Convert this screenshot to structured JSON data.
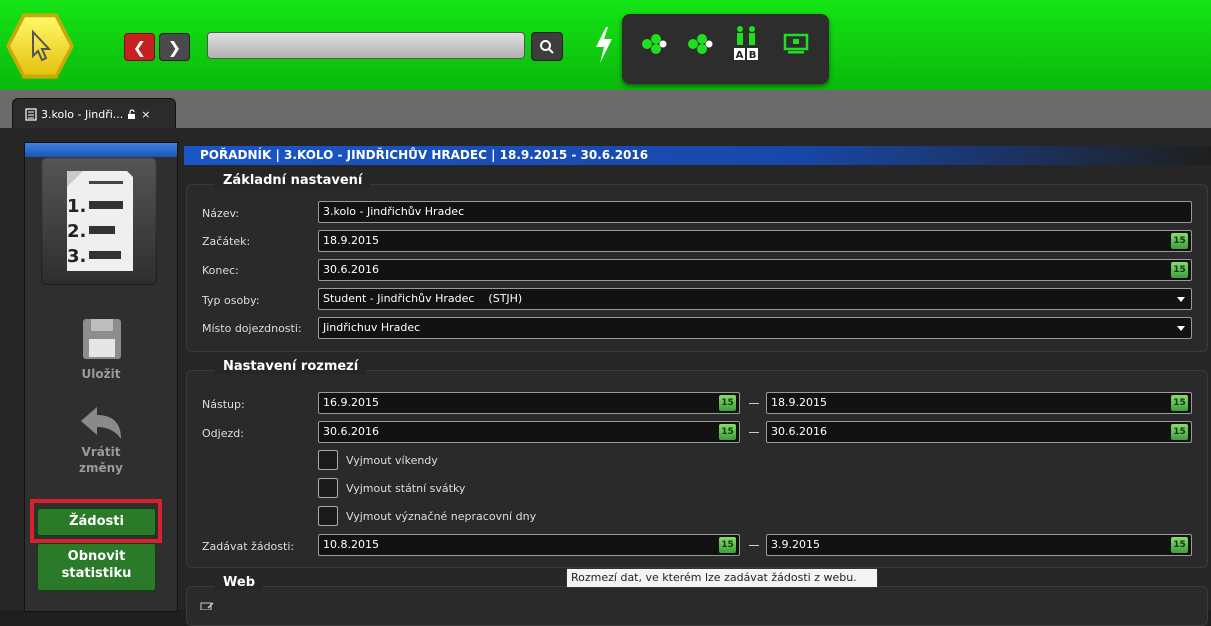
{
  "toolbar": {
    "search_placeholder": "",
    "icons": [
      "cursor-icon",
      "back-arrow-icon",
      "forward-arrow-icon",
      "search-icon",
      "lightning-icon",
      "hexagon-cluster-icon",
      "hexagon-cluster-icon",
      "people-ab-icon",
      "monitor-icon"
    ],
    "tool_ab_label_a": "A",
    "tool_ab_label_b": "B"
  },
  "tab": {
    "label": "3.kolo - Jindři...",
    "close": "×"
  },
  "sidebar": {
    "save_label": "Uložit",
    "revert_line1": "Vrátit",
    "revert_line2": "změny",
    "requests_label": "Žádosti",
    "refresh_line1": "Obnovit",
    "refresh_line2": "statistiku",
    "list_rows": [
      "1.",
      "2.",
      "3."
    ]
  },
  "header": {
    "title": "POŘADNÍK | 3.KOLO - JINDŘICHŮV HRADEC | 18.9.2015 - 30.6.2016"
  },
  "basic": {
    "legend": "Základní nastavení",
    "name_label": "Název:",
    "name_value": "3.kolo - Jindřichův Hradec",
    "start_label": "Začátek:",
    "start_value": "18.9.2015",
    "end_label": "Konec:",
    "end_value": "30.6.2016",
    "type_label": "Typ osoby:",
    "type_value": "Student - Jindřichův Hradec    (STJH)",
    "place_label": "Místo dojezdnosti:",
    "place_value": "Jindřichuv Hradec"
  },
  "range": {
    "legend": "Nastavení rozmezí",
    "arrival_label": "Nástup:",
    "arrival_from": "16.9.2015",
    "arrival_to": "18.9.2015",
    "departure_label": "Odjezd:",
    "departure_from": "30.6.2016",
    "departure_to": "30.6.2016",
    "cb_weekends": "Vyjmout víkendy",
    "cb_holidays": "Vyjmout státní svátky",
    "cb_nonworking": "Vyjmout význačné nepracovní dny",
    "requests_label": "Zadávat žádosti:",
    "requests_from": "10.8.2015",
    "requests_to": "3.9.2015",
    "cal_text": "15",
    "dash": "—"
  },
  "web": {
    "legend": "Web"
  },
  "tooltip": {
    "text": "Rozmezí dat, ve kterém lze zadávat žádosti z webu."
  }
}
